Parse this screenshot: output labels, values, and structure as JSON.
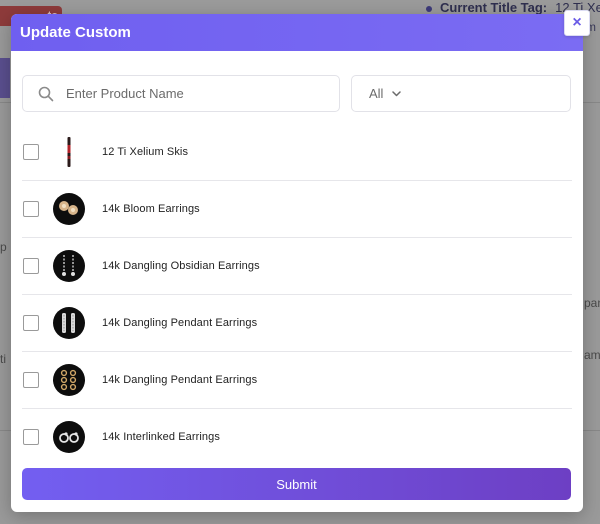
{
  "background": {
    "pill_text": "to",
    "title_tag_label": "Current Title Tag:",
    "title_tag_value": "12 Ti Xe",
    "sub_fragment": "m",
    "edge_left_1": "p",
    "edge_left_2": "ti",
    "edge_right_1": "pan",
    "edge_right_2": "am"
  },
  "modal": {
    "title": "Update Custom",
    "close_glyph": "×",
    "search": {
      "placeholder": "Enter Product Name",
      "value": ""
    },
    "filter": {
      "selected": "All"
    },
    "products": [
      {
        "label": "12 Ti Xelium Skis",
        "thumb": "ski-thumbnail"
      },
      {
        "label": "14k Bloom Earrings",
        "thumb": "bloom-earrings-thumbnail"
      },
      {
        "label": "14k Dangling Obsidian Earrings",
        "thumb": "obsidian-earrings-thumbnail"
      },
      {
        "label": "14k Dangling Pendant Earrings",
        "thumb": "pendant-earrings-thumbnail"
      },
      {
        "label": "14k Dangling Pendant Earrings",
        "thumb": "pendant-earrings-gold-thumbnail"
      },
      {
        "label": "14k Interlinked Earrings",
        "thumb": "interlinked-earrings-thumbnail"
      }
    ],
    "submit_label": "Submit"
  },
  "colors": {
    "header": "#7263f2",
    "submit_start": "#735ff1",
    "submit_end": "#6d3fc4",
    "overlay": "#9a9a9a"
  }
}
